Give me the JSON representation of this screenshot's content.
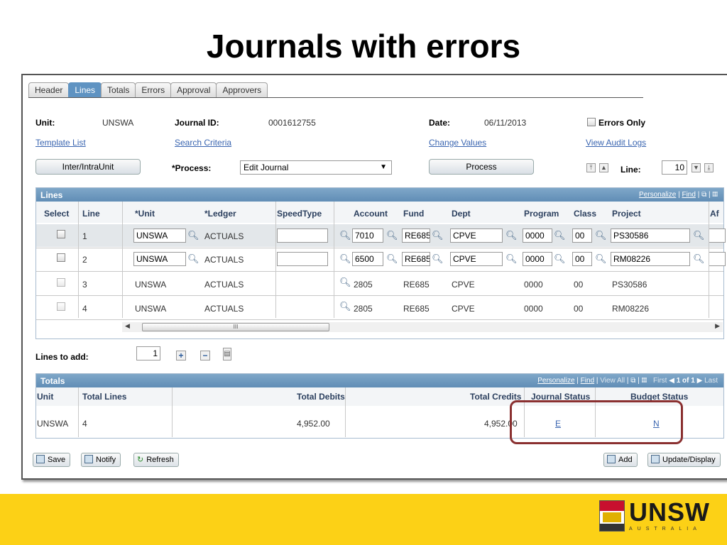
{
  "slide": {
    "title": "Journals with errors"
  },
  "tabs": [
    "Header",
    "Lines",
    "Totals",
    "Errors",
    "Approval",
    "Approvers"
  ],
  "header": {
    "unit_label": "Unit:",
    "unit_value": "UNSWA",
    "journal_label": "Journal ID:",
    "journal_value": "0001612755",
    "date_label": "Date:",
    "date_value": "06/11/2013",
    "errors_only": "Errors Only",
    "links": [
      "Template List",
      "Search Criteria",
      "Change Values",
      "View Audit Logs"
    ],
    "interunit_button": "Inter/IntraUnit",
    "process_label": "*Process:",
    "process_value": "Edit Journal",
    "process_button": "Process",
    "line_label": "Line:",
    "line_value": "10"
  },
  "lines": {
    "title": "Lines",
    "personalize": "Personalize",
    "find": "Find",
    "columns": [
      "Select",
      "Line",
      "*Unit",
      "*Ledger",
      "SpeedType",
      "Account",
      "Fund",
      "Dept",
      "Program",
      "Class",
      "Project",
      "Af"
    ],
    "rows": [
      {
        "line": "1",
        "unit": "UNSWA",
        "ledger": "ACTUALS",
        "account": "7010",
        "fund": "RE685",
        "dept": "CPVE",
        "program": "0000",
        "class": "00",
        "project": "PS30586"
      },
      {
        "line": "2",
        "unit": "UNSWA",
        "ledger": "ACTUALS",
        "account": "6500",
        "fund": "RE685",
        "dept": "CPVE",
        "program": "0000",
        "class": "00",
        "project": "RM08226"
      },
      {
        "line": "3",
        "unit": "UNSWA",
        "ledger": "ACTUALS",
        "account": "2805",
        "fund": "RE685",
        "dept": "CPVE",
        "program": "0000",
        "class": "00",
        "project": "PS30586"
      },
      {
        "line": "4",
        "unit": "UNSWA",
        "ledger": "ACTUALS",
        "account": "2805",
        "fund": "RE685",
        "dept": "CPVE",
        "program": "0000",
        "class": "00",
        "project": "RM08226"
      }
    ],
    "scroll_mark": "III",
    "lines_to_add_label": "Lines to add:",
    "lines_to_add_value": "1"
  },
  "totals": {
    "title": "Totals",
    "personalize": "Personalize",
    "find": "Find",
    "view_all": "View All",
    "first": "First",
    "pager": "1 of 1",
    "last": "Last",
    "columns": [
      "Unit",
      "Total Lines",
      "Total Debits",
      "Total Credits",
      "Journal Status",
      "Budget Status"
    ],
    "row": {
      "unit": "UNSWA",
      "total_lines": "4",
      "total_debits": "4,952.00",
      "total_credits": "4,952.00",
      "journal_status": "E",
      "budget_status": "N"
    }
  },
  "buttons": {
    "save": "Save",
    "notify": "Notify",
    "refresh": "Refresh",
    "add": "Add",
    "update": "Update/Display"
  },
  "logo": {
    "name": "UNSW",
    "sub": "AUSTRALIA"
  }
}
